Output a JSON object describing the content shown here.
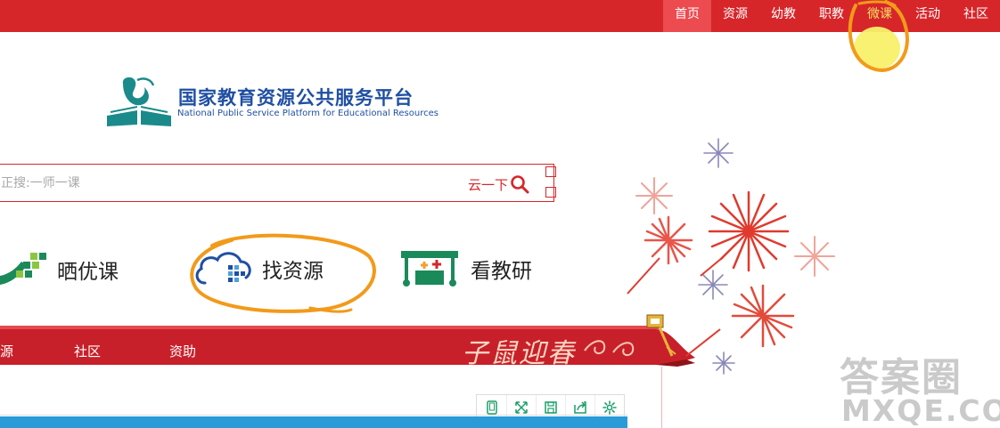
{
  "top_nav": {
    "items": [
      {
        "label": "首页"
      },
      {
        "label": "资源"
      },
      {
        "label": "幼教"
      },
      {
        "label": "职教"
      },
      {
        "label": "微课"
      },
      {
        "label": "活动"
      },
      {
        "label": "社区"
      }
    ],
    "active_index": 0,
    "highlighted_index": 4
  },
  "logo": {
    "title_cn": "国家教育资源公共服务平台",
    "title_en": "National Public Service Platform for Educational Resources"
  },
  "search": {
    "placeholder": "正搜:一师一课",
    "button_label": "云一下",
    "icon": "search-icon"
  },
  "features": [
    {
      "label": "晒优课",
      "icon": "course-grid-icon"
    },
    {
      "label": "找资源",
      "icon": "cloud-resource-icon"
    },
    {
      "label": "看教研",
      "icon": "research-board-icon"
    }
  ],
  "sub_nav": {
    "items": [
      {
        "label": "源"
      },
      {
        "label": "社区"
      },
      {
        "label": "资助"
      }
    ],
    "banner_text": "子鼠迎春"
  },
  "toolbar": {
    "icons": [
      "mobile-icon",
      "fullscreen-icon",
      "save-icon",
      "share-icon",
      "settings-icon"
    ]
  },
  "watermark": {
    "text_cn": "答案圈",
    "text_en": "MXQE.COM"
  },
  "colors": {
    "brand_red": "#d6262a",
    "active_nav": "#ec4b4f",
    "logo_blue": "#1f4fa3",
    "logo_teal": "#1b8a8a",
    "annotation_orange": "#f29a1a",
    "highlight_yellow": "#f8f06a"
  }
}
